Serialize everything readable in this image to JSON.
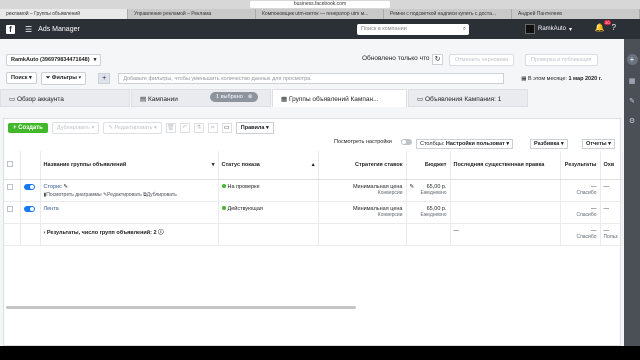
{
  "browser": {
    "url": "business.facebook.com",
    "tabs": [
      "рекламой – Группы объявлений",
      "Управление рекламой – Реклама",
      "Компоновщик utm-меток — генератор utm м...",
      "Ремни с подсветкой надписи купить с доста...",
      "Андрей Пантелеев"
    ]
  },
  "topbar": {
    "app_title": "Ads Manager",
    "search_placeholder": "Поиск в компании",
    "account_name": "RamkAuto",
    "notif_count": "20"
  },
  "account_row": {
    "account_select": "RamkAuto (396979834471648)",
    "updated": "Обновлено только что",
    "discard_label": "Отменить черновики",
    "review_label": "Проверка и публикация"
  },
  "filter_row": {
    "search_label": "Поиск",
    "filters_label": "Фильтры",
    "hint": "Добавьте фильтры, чтобы уменьшить количество данных для просмотра.",
    "month_prefix": "В этом месяце:",
    "month_value": "1 мар 2020 г."
  },
  "nav_tabs": {
    "overview": "Обзор аккаунта",
    "campaigns": "Кампании",
    "selected_pill": "1 выбрано",
    "adsets": "Группы объявлений Кампан...",
    "ads": "Объявления Кампания: 1"
  },
  "toolbar": {
    "create": "Создать",
    "duplicate": "Дублировать",
    "edit": "Редактировать",
    "rules": "Правила"
  },
  "settings_row": {
    "see_settings": "Посмотреть настройки",
    "columns_label": "Столбцы:",
    "columns_value": "Настройки пользоват",
    "breakdown": "Разбивка",
    "reports": "Отчеты"
  },
  "table": {
    "headers": {
      "name": "Название группы объявлений",
      "status": "Статус показа",
      "strategy": "Стратегия ставок",
      "budget": "Бюджет",
      "last_edit": "Последняя существенная правка",
      "results": "Результаты",
      "reach": "Охв"
    },
    "rows": [
      {
        "name": "Сторис",
        "status": "На проверке",
        "strategy": "Минимальная цена",
        "strategy_sub": "Конверсии",
        "budget": "65,00 р.",
        "budget_sub": "Ежедневно",
        "results": "—",
        "results_sub": "Спасибо",
        "reach": "—",
        "actions": [
          "Посмотреть диаграммы",
          "Редактировать",
          "Дублировать"
        ]
      },
      {
        "name": "Лента",
        "status": "Действующая",
        "strategy": "Минимальная цена",
        "strategy_sub": "Конверсии",
        "budget": "65,00 р.",
        "budget_sub": "Ежедневно",
        "results": "—",
        "results_sub": "Спасибо",
        "reach": "—",
        "actions": []
      }
    ],
    "totals": {
      "label": "Результаты, число групп объявлений: 2",
      "last_edit": "—",
      "results": "—",
      "results_sub": "Спасибо",
      "reach": "—",
      "reach_sub": "Польз"
    }
  }
}
